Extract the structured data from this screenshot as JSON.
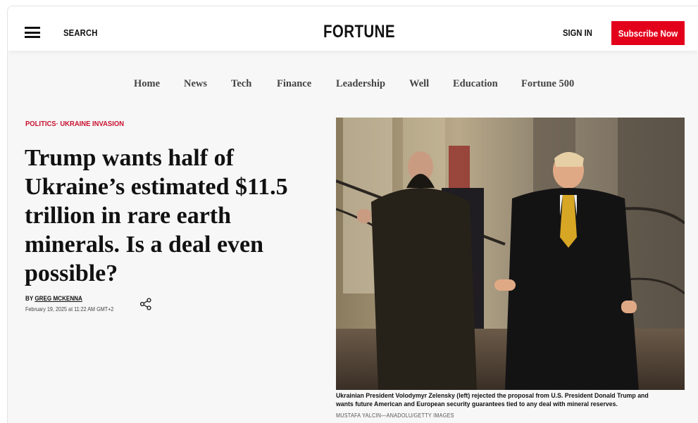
{
  "header": {
    "search_label": "SEARCH",
    "logo": "FORTUNE",
    "signin_label": "SIGN IN",
    "subscribe_label": "Subscribe Now",
    "subscribe_color": "#e3001b"
  },
  "nav": {
    "items": [
      "Home",
      "News",
      "Tech",
      "Finance",
      "Leadership",
      "Well",
      "Education",
      "Fortune 500"
    ]
  },
  "article": {
    "kicker_1": "POLITICS",
    "kicker_sep": "·",
    "kicker_2": "UKRAINE INVASION",
    "kicker_color": "#c8102e",
    "headline": "Trump wants half of Ukraine’s estimated $11.5 trillion in rare earth minerals. Is a deal even possible?",
    "byline_prefix": "BY",
    "author": "GREG MCKENNA",
    "date": "February 19, 2025 at 11:22 AM GMT+2",
    "photo": {
      "caption": "Ukrainian President Volodymyr Zelensky (left) rejected the proposal from U.S. President Donald Trump and wants future American and European security guarantees tied to any deal with mineral reserves.",
      "credit": "MUSTAFA YALCIN—ANADOLU/GETTY IMAGES"
    }
  },
  "icons": {
    "menu": "hamburger-menu-icon",
    "share": "share-icon"
  }
}
